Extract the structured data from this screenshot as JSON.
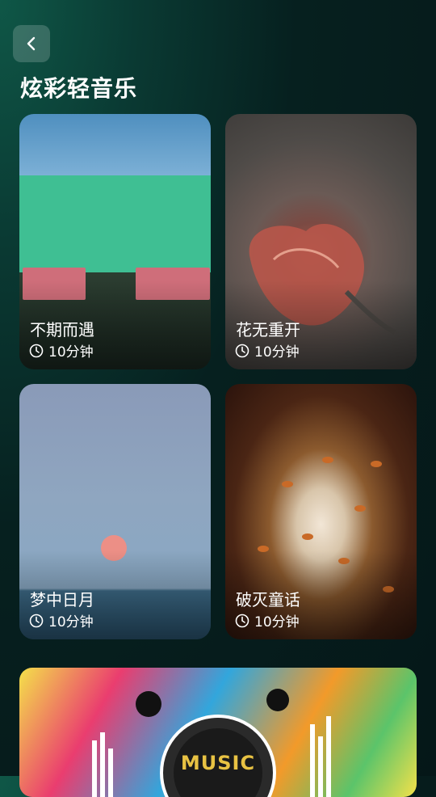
{
  "header": {
    "back_icon": "chevron-left-icon",
    "title": "炫彩轻音乐"
  },
  "cards": [
    {
      "title": "不期而遇",
      "duration": "10分钟"
    },
    {
      "title": "花无重开",
      "duration": "10分钟"
    },
    {
      "title": "梦中日月",
      "duration": "10分钟"
    },
    {
      "title": "破灭童话",
      "duration": "10分钟"
    }
  ],
  "banner": {
    "title": "MUSIC"
  },
  "colors": {
    "background": "#061d1d",
    "card_text": "#ffffff"
  }
}
